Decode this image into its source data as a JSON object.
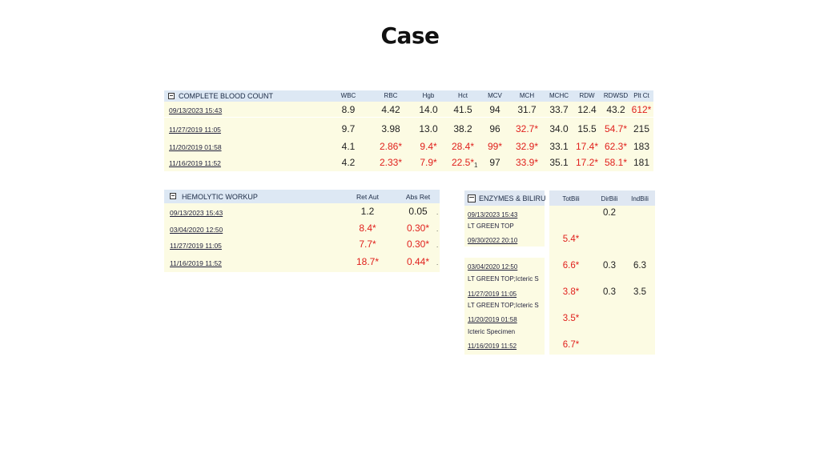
{
  "title": "Case",
  "cbc": {
    "header": "COMPLETE BLOOD COUNT",
    "columns": [
      "WBC",
      "RBC",
      "Hgb",
      "Hct",
      "MCV",
      "MCH",
      "MCHC",
      "RDW",
      "RDWSD",
      "Plt Ct"
    ],
    "rows": [
      {
        "date": "09/13/2023 15:43",
        "values": [
          "8.9",
          "4.42",
          "14.0",
          "41.5",
          "94",
          "31.7",
          "33.7",
          "12.4",
          "43.2",
          "612*"
        ],
        "abnormal": [
          false,
          false,
          false,
          false,
          false,
          false,
          false,
          false,
          false,
          true
        ]
      },
      {
        "date": "11/27/2019 11:05",
        "values": [
          "9.7",
          "3.98",
          "13.0",
          "38.2",
          "96",
          "32.7*",
          "34.0",
          "15.5",
          "54.7*",
          "215"
        ],
        "abnormal": [
          false,
          false,
          false,
          false,
          false,
          true,
          false,
          false,
          true,
          false
        ]
      },
      {
        "date": "11/20/2019 01:58",
        "values": [
          "4.1",
          "2.86*",
          "9.4*",
          "28.4*",
          "99*",
          "32.9*",
          "33.1",
          "17.4*",
          "62.3*",
          "183"
        ],
        "abnormal": [
          false,
          true,
          true,
          true,
          true,
          true,
          false,
          true,
          true,
          false
        ]
      },
      {
        "date": "11/16/2019 11:52",
        "values": [
          "4.2",
          "2.33*",
          "7.9*",
          "22.5*",
          "97",
          "33.9*",
          "35.1",
          "17.2*",
          "58.1*",
          "181"
        ],
        "abnormal": [
          false,
          true,
          true,
          true,
          false,
          true,
          false,
          true,
          true,
          false
        ]
      }
    ],
    "footnote_mark": "1"
  },
  "hemolytic": {
    "header": "HEMOLYTIC WORKUP",
    "columns": [
      "Ret Aut",
      "Abs Ret"
    ],
    "rows": [
      {
        "date": "09/13/2023 15:43",
        "values": [
          "1.2",
          "0.05"
        ],
        "abnormal": [
          false,
          false
        ]
      },
      {
        "date": "03/04/2020 12:50",
        "values": [
          "8.4*",
          "0.30*"
        ],
        "abnormal": [
          true,
          true
        ]
      },
      {
        "date": "11/27/2019 11:05",
        "values": [
          "7.7*",
          "0.30*"
        ],
        "abnormal": [
          true,
          true
        ]
      },
      {
        "date": "11/16/2019 11:52",
        "values": [
          "18.7*",
          "0.44*"
        ],
        "abnormal": [
          true,
          true
        ]
      }
    ]
  },
  "enzymes": {
    "header": "ENZYMES & BILIRU",
    "columns": [
      "TotBili",
      "DirBili",
      "IndBili"
    ],
    "rows": [
      {
        "date": "09/13/2023 15:43",
        "note": "LT GREEN TOP",
        "tot": "",
        "dir": "0.2",
        "ind": ""
      },
      {
        "date": "09/30/2022 20:10",
        "note": "",
        "tot": "5.4*",
        "dir": "",
        "ind": ""
      },
      {
        "date": "03/04/2020 12:50",
        "note": "LT GREEN TOP;Icteric S",
        "tot": "6.6*",
        "dir": "0.3",
        "ind": "6.3"
      },
      {
        "date": "11/27/2019 11:05",
        "note": "LT GREEN TOP;Icteric S",
        "tot": "3.8*",
        "dir": "0.3",
        "ind": "3.5"
      },
      {
        "date": "11/20/2019 01:58",
        "note": "Icteric Specimen",
        "tot": "3.5*",
        "dir": "",
        "ind": ""
      },
      {
        "date": "11/16/2019 11:52",
        "note": "",
        "tot": "6.7*",
        "dir": "",
        "ind": ""
      }
    ]
  }
}
